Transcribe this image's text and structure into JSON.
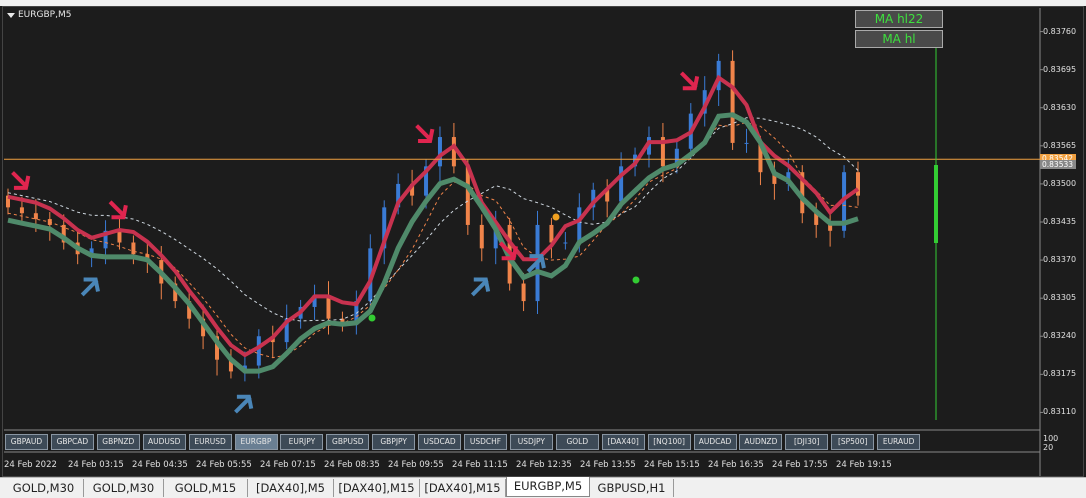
{
  "window": {
    "chart_title": "EURGBP,M5"
  },
  "legend_buttons": [
    {
      "label": "MA hl22",
      "color": "#3ee03e"
    },
    {
      "label": "MA hl",
      "color": "#3ee03e"
    }
  ],
  "price_axis": {
    "ticks": [
      "0.83760",
      "0.83695",
      "0.83630",
      "0.83565",
      "0.83500",
      "0.83435",
      "0.83370",
      "0.83305",
      "0.83240",
      "0.83175",
      "0.83110"
    ],
    "current_price_upper": "0.83542",
    "current_price_lower": "0.83533",
    "indicator_labels": [
      "100",
      "20"
    ]
  },
  "time_axis": {
    "ticks": [
      "24 Feb 2022",
      "24 Feb 03:15",
      "24 Feb 04:35",
      "24 Feb 05:55",
      "24 Feb 07:15",
      "24 Feb 08:35",
      "24 Feb 09:55",
      "24 Feb 11:15",
      "24 Feb 12:35",
      "24 Feb 13:55",
      "24 Feb 15:15",
      "24 Feb 16:35",
      "24 Feb 17:55",
      "24 Feb 19:15"
    ]
  },
  "symbol_buttons": [
    {
      "label": "GBPAUD"
    },
    {
      "label": "GBPCAD"
    },
    {
      "label": "GBPNZD"
    },
    {
      "label": "AUDUSD"
    },
    {
      "label": "EURUSD"
    },
    {
      "label": "EURGBP",
      "active": true
    },
    {
      "label": "EURJPY"
    },
    {
      "label": "GBPUSD"
    },
    {
      "label": "GBPJPY"
    },
    {
      "label": "USDCAD"
    },
    {
      "label": "USDCHF"
    },
    {
      "label": "USDJPY"
    },
    {
      "label": "GOLD"
    },
    {
      "label": "[DAX40]"
    },
    {
      "label": "[NQ100]"
    },
    {
      "label": "AUDCAD"
    },
    {
      "label": "AUDNZD"
    },
    {
      "label": "[DJI30]"
    },
    {
      "label": "[SP500]"
    },
    {
      "label": "EURAUD"
    }
  ],
  "tabs": [
    {
      "label": "GOLD,M30"
    },
    {
      "label": "GOLD,M30"
    },
    {
      "label": "GOLD,M15"
    },
    {
      "label": "[DAX40],M5"
    },
    {
      "label": "[DAX40],M15"
    },
    {
      "label": "[DAX40],M15"
    },
    {
      "label": "EURGBP,M5",
      "active": true
    },
    {
      "label": "GBPUSD,H1"
    }
  ],
  "colors": {
    "bull": "#3a7bd5",
    "bear": "#f0844a",
    "ma_upper": "#c8324f",
    "ma_lower": "#4f8a6a",
    "bid_line": "#f0a040",
    "indicator": "#33cc33"
  },
  "chart_data": {
    "type": "candlestick",
    "symbol": "EURGBP",
    "timeframe": "M5",
    "ylim": [
      0.8308,
      0.8379
    ],
    "close_series": [
      0.8346,
      0.8345,
      0.8344,
      0.8343,
      0.834,
      0.8338,
      0.8339,
      0.8342,
      0.834,
      0.8338,
      0.8337,
      0.8333,
      0.833,
      0.8327,
      0.8324,
      0.832,
      0.8318,
      0.8319,
      0.8324,
      0.8323,
      0.8327,
      0.8329,
      0.8331,
      0.8327,
      0.8326,
      0.833,
      0.8339,
      0.8346,
      0.835,
      0.8348,
      0.8353,
      0.8358,
      0.8353,
      0.8343,
      0.8339,
      0.8343,
      0.8333,
      0.833,
      0.8343,
      0.834,
      0.834,
      0.8346,
      0.8349,
      0.8347,
      0.8353,
      0.8355,
      0.8358,
      0.8353,
      0.8356,
      0.8362,
      0.8366,
      0.8371,
      0.8357,
      0.8357,
      0.8352,
      0.835,
      0.8352,
      0.8345,
      0.8343,
      0.8342,
      0.8352,
      0.8348
    ],
    "arrows": [
      {
        "dir": "down",
        "color": "#e0254f",
        "i": 1
      },
      {
        "dir": "up",
        "color": "#4a86b8",
        "i": 6
      },
      {
        "dir": "down",
        "color": "#e0254f",
        "i": 8
      },
      {
        "dir": "up",
        "color": "#4a86b8",
        "i": 17
      },
      {
        "dir": "down",
        "color": "#e0254f",
        "i": 30
      },
      {
        "dir": "up",
        "color": "#4a86b8",
        "i": 34
      },
      {
        "dir": "down",
        "color": "#e0254f",
        "i": 36
      },
      {
        "dir": "up",
        "color": "#4a86b8",
        "i": 38
      },
      {
        "dir": "down",
        "color": "#e0254f",
        "i": 49
      }
    ]
  }
}
